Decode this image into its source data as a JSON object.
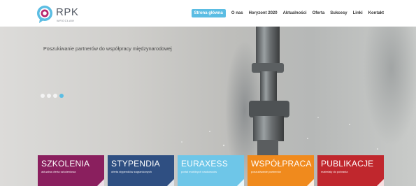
{
  "header": {
    "logo_text": "RPK",
    "logo_sub": "WROCŁAW",
    "nav": [
      {
        "label": "Strona główna",
        "active": true
      },
      {
        "label": "O nas"
      },
      {
        "label": "Horyzont 2020"
      },
      {
        "label": "Aktualności"
      },
      {
        "label": "Oferta"
      },
      {
        "label": "Sukcesy"
      },
      {
        "label": "Linki"
      },
      {
        "label": "Kontakt"
      }
    ]
  },
  "hero": {
    "headline": "Poszukiwanie partnerów do współpracy międzynarodowej",
    "slider": {
      "count": 4,
      "active": 4
    }
  },
  "tiles": [
    {
      "title": "SZKOLENIA",
      "subtitle": "aktualna oferta szkoleniowa",
      "color": "#8a1f5e"
    },
    {
      "title": "STYPENDIA",
      "subtitle": "oferta stypendiów zagranicznych",
      "color": "#2f4f82"
    },
    {
      "title": "EURAXESS",
      "subtitle": "portal mobilnych naukowców",
      "color": "#6ec6e8"
    },
    {
      "title": "WSPÓŁPRACA",
      "subtitle": "poszukiwanie partnerów",
      "color": "#f08a1d"
    },
    {
      "title": "PUBLIKACJE",
      "subtitle": "materiały do pobrania",
      "color": "#c0272d"
    }
  ],
  "colors": {
    "accent": "#5bbde3",
    "logo_blue": "#5bbde3",
    "logo_magenta": "#b8276d"
  }
}
